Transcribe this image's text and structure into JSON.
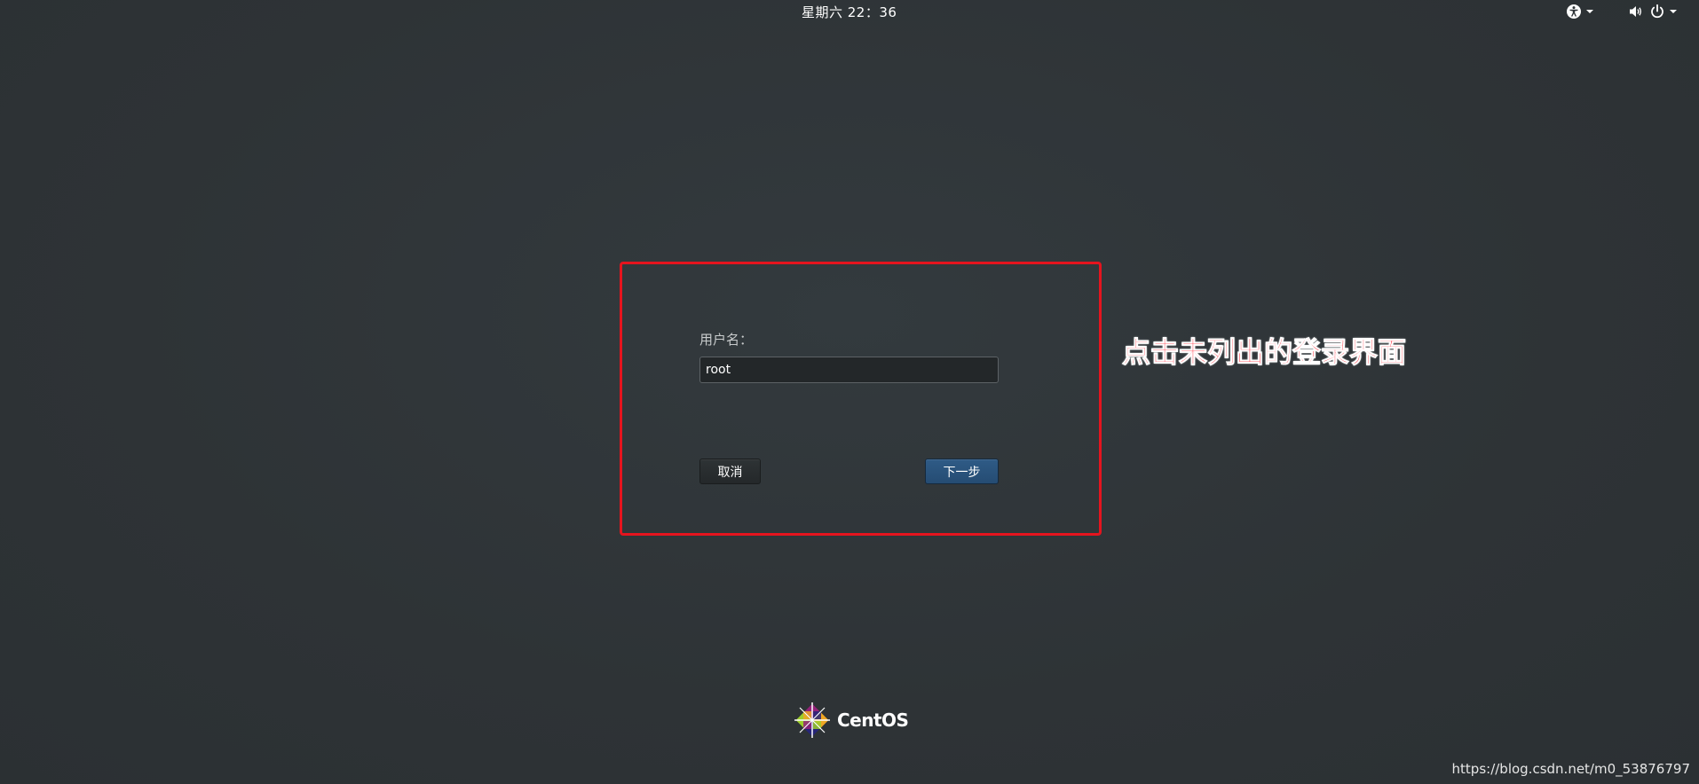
{
  "topbar": {
    "clock": "星期六 22：36",
    "accessibility_icon": "accessibility-icon",
    "volume_icon": "volume-icon",
    "power_icon": "power-icon",
    "menu_caret_icon": "chevron-down-icon"
  },
  "login": {
    "username_label": "用户名：",
    "username_value": "root",
    "cancel_label": "取消",
    "next_label": "下一步"
  },
  "annotation": {
    "caption": "点击未列出的登录界面",
    "frame_color": "#e5141e",
    "caption_color": "#ff2a38"
  },
  "branding": {
    "logo_text": "CentOS",
    "logo_icon": "centos-logo-icon"
  },
  "watermark": {
    "text": "https://blog.csdn.net/m0_53876797"
  },
  "colors": {
    "background": "#2f3438",
    "next_button": "#2f5b86",
    "input_background": "#232729"
  }
}
